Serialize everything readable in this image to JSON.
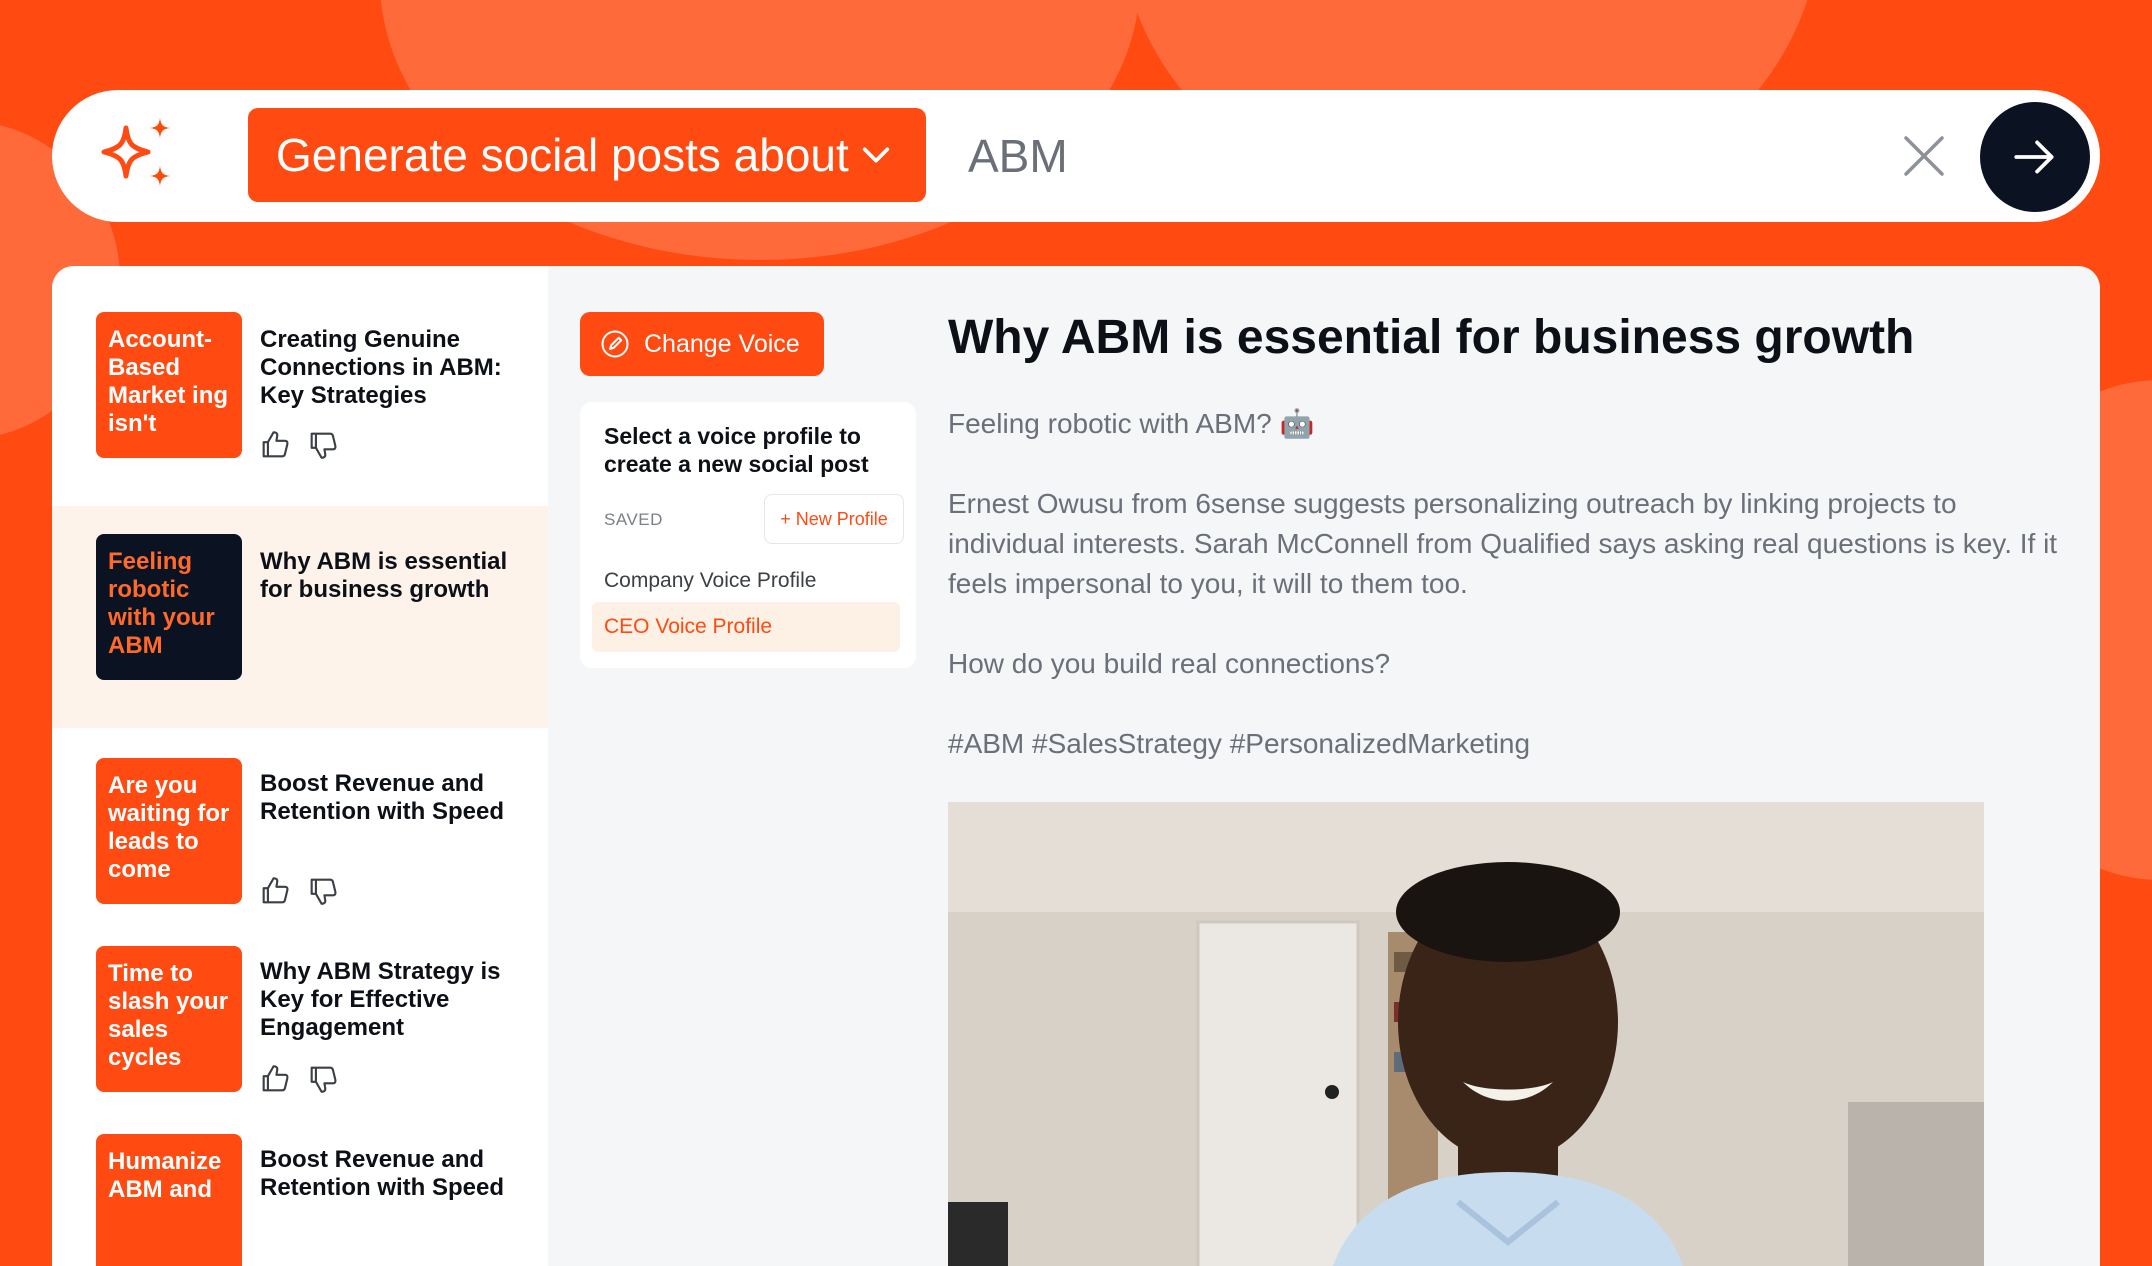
{
  "search": {
    "mode_label": "Generate social posts about",
    "query": "ABM"
  },
  "posts": [
    {
      "thumb": "Account-Based Market ing isn't",
      "title": "Creating Genuine Connections in ABM: Key Strategies"
    },
    {
      "thumb": "Feeling robotic with your ABM",
      "title": "Why ABM is essential for business growth"
    },
    {
      "thumb": "Are you waiting for leads to come",
      "title": "Boost Revenue and Retention with Speed"
    },
    {
      "thumb": "Time to slash your sales cycles",
      "title": "Why ABM Strategy is Key for Effective Engagement"
    },
    {
      "thumb": "Humanize ABM and",
      "title": "Boost Revenue and Retention with Speed"
    }
  ],
  "voice": {
    "change_label": "Change Voice",
    "heading": "Select a voice profile to create a new social post",
    "saved_label": "SAVED",
    "new_profile_label": "+ New Profile",
    "options": [
      "Company Voice Profile",
      "CEO Voice Profile"
    ]
  },
  "post": {
    "title": "Why ABM is essential for business growth",
    "p1": "Feeling robotic with ABM? 🤖",
    "p2": "Ernest Owusu from 6sense suggests personalizing outreach by linking projects to individual interests. Sarah McConnell from Qualified says asking real questions is key. If it feels impersonal to you, it will to them too.",
    "p3": "How do you build real connections?",
    "p4": "#ABM #SalesStrategy #PersonalizedMarketing"
  },
  "colors": {
    "brand_orange": "#ff4a12",
    "dark_navy": "#0b1221",
    "selected_row": "#fdf3ea"
  }
}
